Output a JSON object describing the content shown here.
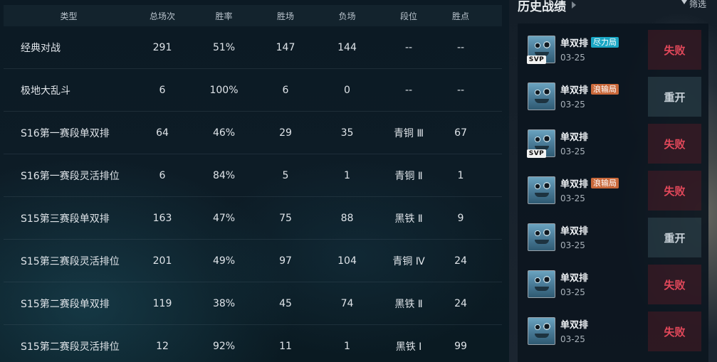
{
  "table": {
    "headers": [
      "类型",
      "总场次",
      "胜率",
      "胜场",
      "负场",
      "段位",
      "胜点"
    ],
    "rows": [
      {
        "type": "经典对战",
        "total": "291",
        "rate": "51%",
        "wins": "147",
        "losses": "144",
        "rank": "--",
        "points": "--"
      },
      {
        "type": "极地大乱斗",
        "total": "6",
        "rate": "100%",
        "wins": "6",
        "losses": "0",
        "rank": "--",
        "points": "--"
      },
      {
        "type": "S16第一赛段单双排",
        "total": "64",
        "rate": "46%",
        "wins": "29",
        "losses": "35",
        "rank": "青铜 Ⅲ",
        "points": "67"
      },
      {
        "type": "S16第一赛段灵活排位",
        "total": "6",
        "rate": "84%",
        "wins": "5",
        "losses": "1",
        "rank": "青铜 Ⅱ",
        "points": "1"
      },
      {
        "type": "S15第三赛段单双排",
        "total": "163",
        "rate": "47%",
        "wins": "75",
        "losses": "88",
        "rank": "黑铁 Ⅱ",
        "points": "9"
      },
      {
        "type": "S15第三赛段灵活排位",
        "total": "201",
        "rate": "49%",
        "wins": "97",
        "losses": "104",
        "rank": "青铜 Ⅳ",
        "points": "24"
      },
      {
        "type": "S15第二赛段单双排",
        "total": "119",
        "rate": "38%",
        "wins": "45",
        "losses": "74",
        "rank": "黑铁 Ⅱ",
        "points": "24"
      },
      {
        "type": "S15第二赛段灵活排位",
        "total": "12",
        "rate": "92%",
        "wins": "11",
        "losses": "1",
        "rank": "黑铁 Ⅰ",
        "points": "99"
      }
    ]
  },
  "history": {
    "title": "历史战绩",
    "filter_label": "筛选",
    "matches": [
      {
        "mode": "单双排",
        "tag": "尽力局",
        "tag_color": "#1aa6c4",
        "date": "03-25",
        "result": "失败",
        "svp": "SVP"
      },
      {
        "mode": "单双排",
        "tag": "浪输局",
        "tag_color": "#c9683a",
        "date": "03-25",
        "result": "重开",
        "svp": ""
      },
      {
        "mode": "单双排",
        "tag": "",
        "tag_color": "",
        "date": "03-25",
        "result": "失败",
        "svp": "SVP"
      },
      {
        "mode": "单双排",
        "tag": "浪输局",
        "tag_color": "#c9683a",
        "date": "03-25",
        "result": "失败",
        "svp": ""
      },
      {
        "mode": "单双排",
        "tag": "",
        "tag_color": "",
        "date": "03-25",
        "result": "重开",
        "svp": ""
      },
      {
        "mode": "单双排",
        "tag": "",
        "tag_color": "",
        "date": "03-25",
        "result": "失败",
        "svp": ""
      },
      {
        "mode": "单双排",
        "tag": "",
        "tag_color": "",
        "date": "03-25",
        "result": "失败",
        "svp": ""
      }
    ]
  },
  "colors": {
    "lose": "#e2485a",
    "remake": "#c8d1d8",
    "accent": "#1aa6c4"
  }
}
